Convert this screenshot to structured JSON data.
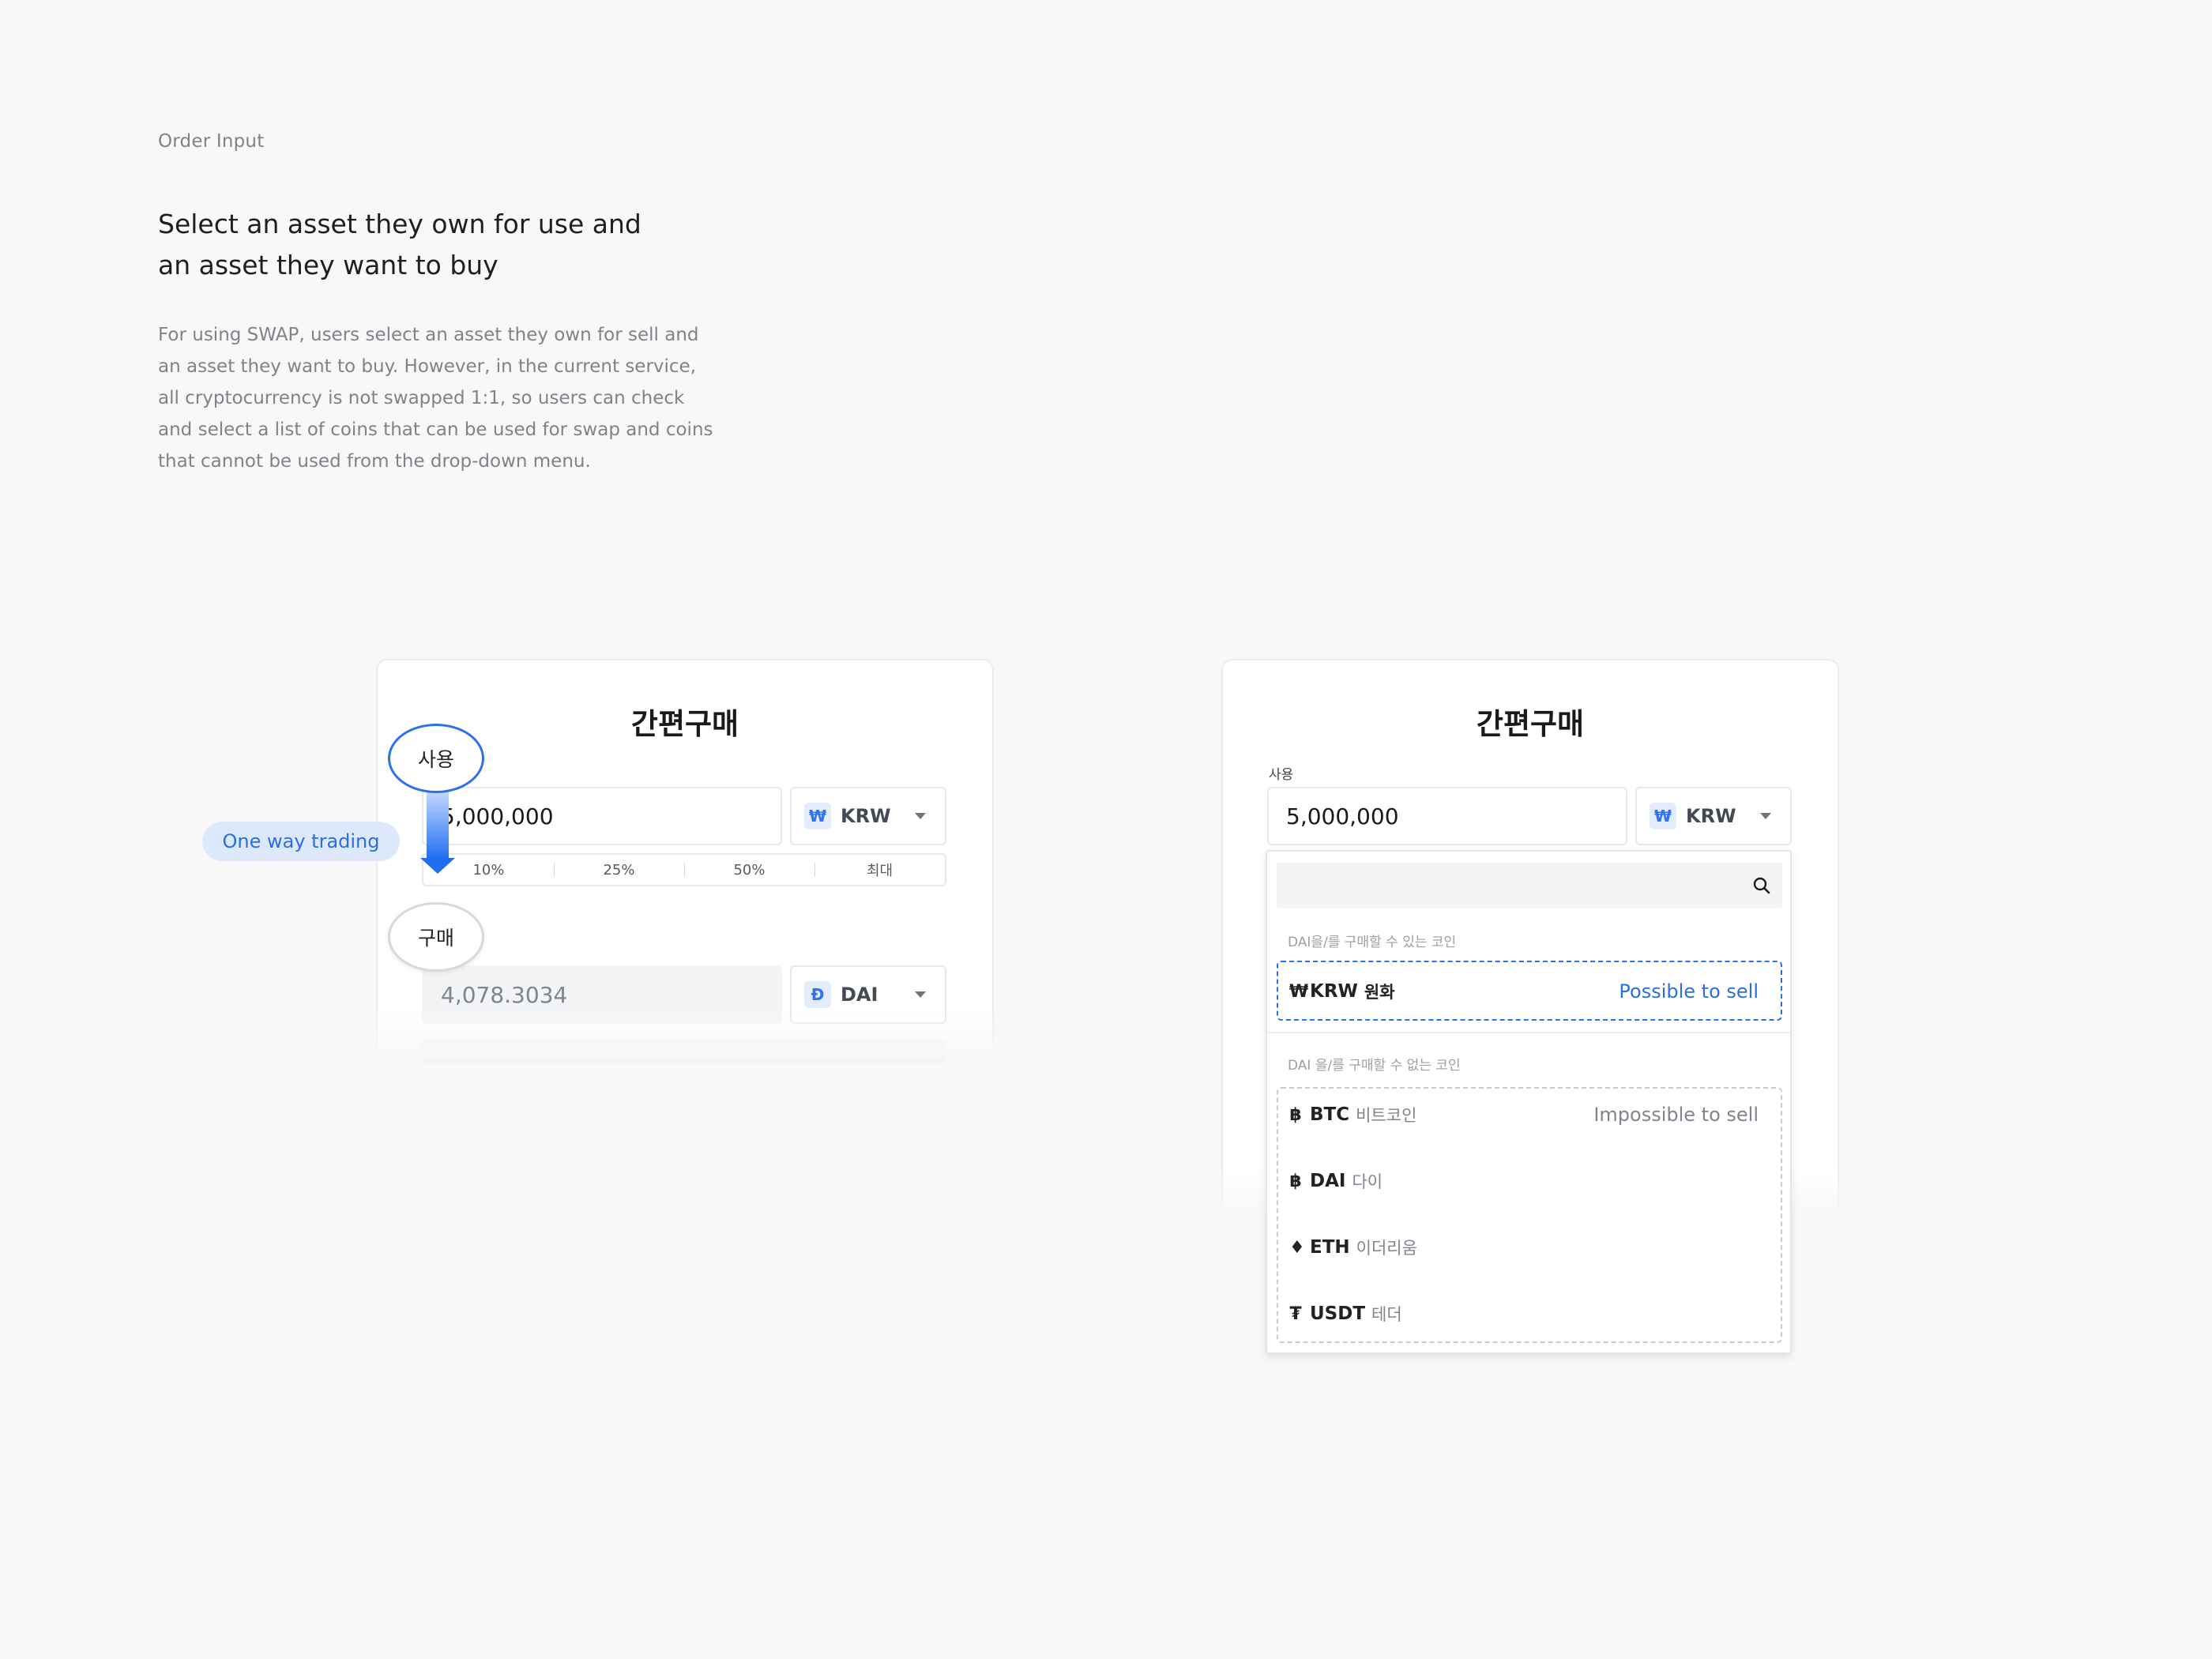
{
  "intro": {
    "section_label": "Order Input",
    "headline_line1": "Select an asset they own for use and",
    "headline_line2": "an asset they want to buy",
    "description": "For using SWAP, users select an asset they own for sell and an asset they want to buy. However, in the current service, all cryptocurrency is not swapped 1:1, so users can check and select a list of coins that can be used for swap and coins that cannot be used from the drop-down menu."
  },
  "left_card": {
    "title": "간편구매",
    "pay_bubble": "사용",
    "buy_bubble": "구매",
    "one_way_pill": "One way trading",
    "pay_amount": "5,000,000",
    "pay_currency": "KRW",
    "pay_currency_symbol": "₩",
    "percent_buttons": [
      "10%",
      "25%",
      "50%",
      "최대"
    ],
    "buy_amount": "4,078.3034",
    "buy_currency": "DAI",
    "buy_currency_symbol": "Đ"
  },
  "right_card": {
    "title": "간편구매",
    "pay_label": "사용",
    "pay_amount": "5,000,000",
    "pay_currency": "KRW",
    "pay_currency_symbol": "₩",
    "dropdown": {
      "search_value": "",
      "available_label": "DAI을/를 구매할 수 있는 코인",
      "unavailable_label": "DAI 을/를 구매할 수 없는 코인",
      "available": [
        {
          "symbol": "₩",
          "ticker": "KRW",
          "name": "원화",
          "status": "Possible to sell"
        }
      ],
      "unavailable": [
        {
          "symbol": "฿",
          "ticker": "BTC",
          "name": "비트코인",
          "status": "Impossible to sell"
        },
        {
          "symbol": "฿",
          "ticker": "DAI",
          "name": "다이",
          "status": ""
        },
        {
          "symbol": "♦",
          "ticker": "ETH",
          "name": "이더리움",
          "status": ""
        },
        {
          "symbol": "₮",
          "ticker": "USDT",
          "name": "테더",
          "status": ""
        }
      ]
    }
  }
}
